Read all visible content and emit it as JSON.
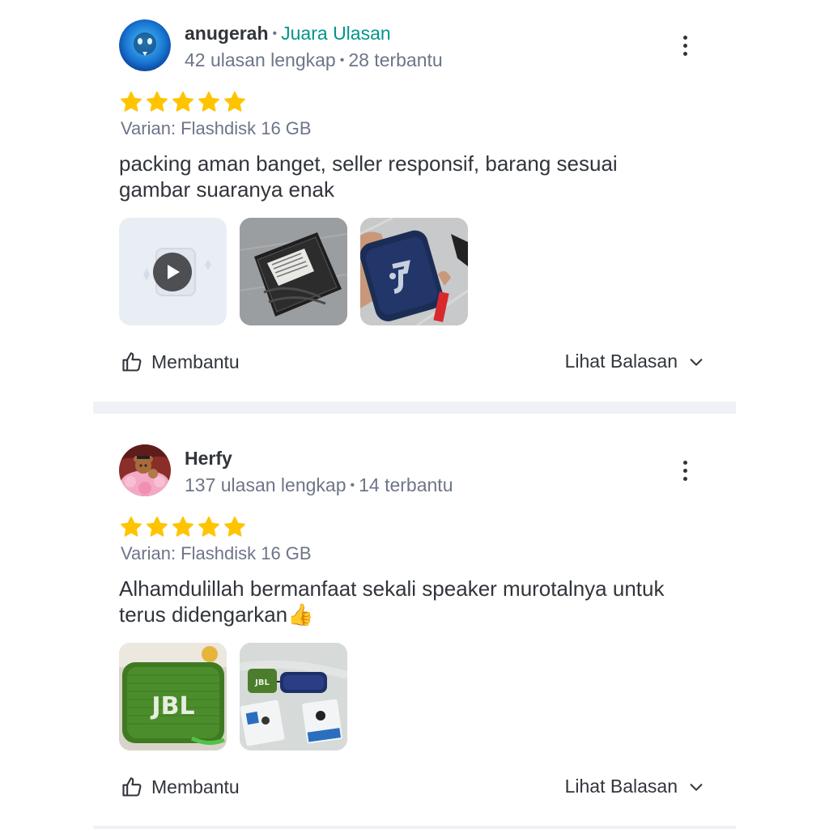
{
  "reviews": [
    {
      "username": "anugerah",
      "badge": "Juara Ulasan",
      "stats": "42 ulasan lengkap",
      "helpful_count": "28 terbantu",
      "rating": 5,
      "variant": "Varian: Flashdisk 16 GB",
      "text_line1": "packing aman banget, seller responsif, barang sesuai",
      "text_line2": "gambar suaranya enak",
      "helpful_label": "Membantu",
      "reply_label": "Lihat Balasan"
    },
    {
      "username": "Herfy",
      "stats": "137 ulasan lengkap",
      "helpful_count": "14 terbantu",
      "rating": 5,
      "variant": "Varian: Flashdisk 16 GB",
      "text_line1": "Alhamdulillah bermanfaat sekali speaker murotalnya untuk",
      "text_line2": "terus didengarkan👍",
      "helpful_label": "Membantu",
      "reply_label": "Lihat Balasan"
    }
  ],
  "photo_labels": {
    "jbl_brand": "JBL"
  },
  "colors": {
    "badge": "#00968a",
    "star": "#ffc400",
    "divider": "#eef2f6",
    "muted": "#6d7588"
  },
  "icons": [
    "more-vertical-icon",
    "star-icon",
    "play-icon",
    "thumbs-up-icon",
    "chevron-down-icon"
  ]
}
